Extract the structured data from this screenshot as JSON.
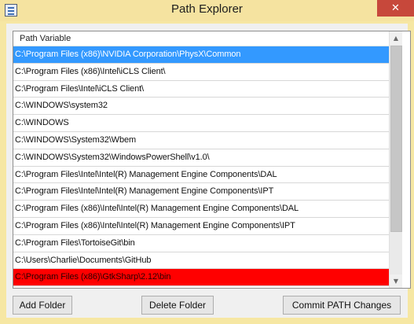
{
  "window": {
    "title": "Path Explorer",
    "close_glyph": "✕"
  },
  "list": {
    "column_header": "Path Variable",
    "selected_index": 0,
    "highlight_index": 13,
    "highlight_color": "#ff0000",
    "selection_color": "#3399ff",
    "items": [
      "C:\\Program Files (x86)\\NVIDIA Corporation\\PhysX\\Common",
      "C:\\Program Files (x86)\\Intel\\iCLS Client\\",
      "C:\\Program Files\\Intel\\iCLS Client\\",
      "C:\\WINDOWS\\system32",
      "C:\\WINDOWS",
      "C:\\WINDOWS\\System32\\Wbem",
      "C:\\WINDOWS\\System32\\WindowsPowerShell\\v1.0\\",
      "C:\\Program Files\\Intel\\Intel(R) Management Engine Components\\DAL",
      "C:\\Program Files\\Intel\\Intel(R) Management Engine Components\\IPT",
      "C:\\Program Files (x86)\\Intel\\Intel(R) Management Engine Components\\DAL",
      "C:\\Program Files (x86)\\Intel\\Intel(R) Management Engine Components\\IPT",
      "C:\\Program Files\\TortoiseGit\\bin",
      "C:\\Users\\Charlie\\Documents\\GitHub",
      "C:\\Program Files (x86)\\GtkSharp\\2.12\\bin"
    ]
  },
  "scrollbar": {
    "up_glyph": "▲",
    "down_glyph": "▼"
  },
  "buttons": {
    "add": "Add Folder",
    "delete": "Delete Folder",
    "commit": "Commit PATH Changes"
  }
}
